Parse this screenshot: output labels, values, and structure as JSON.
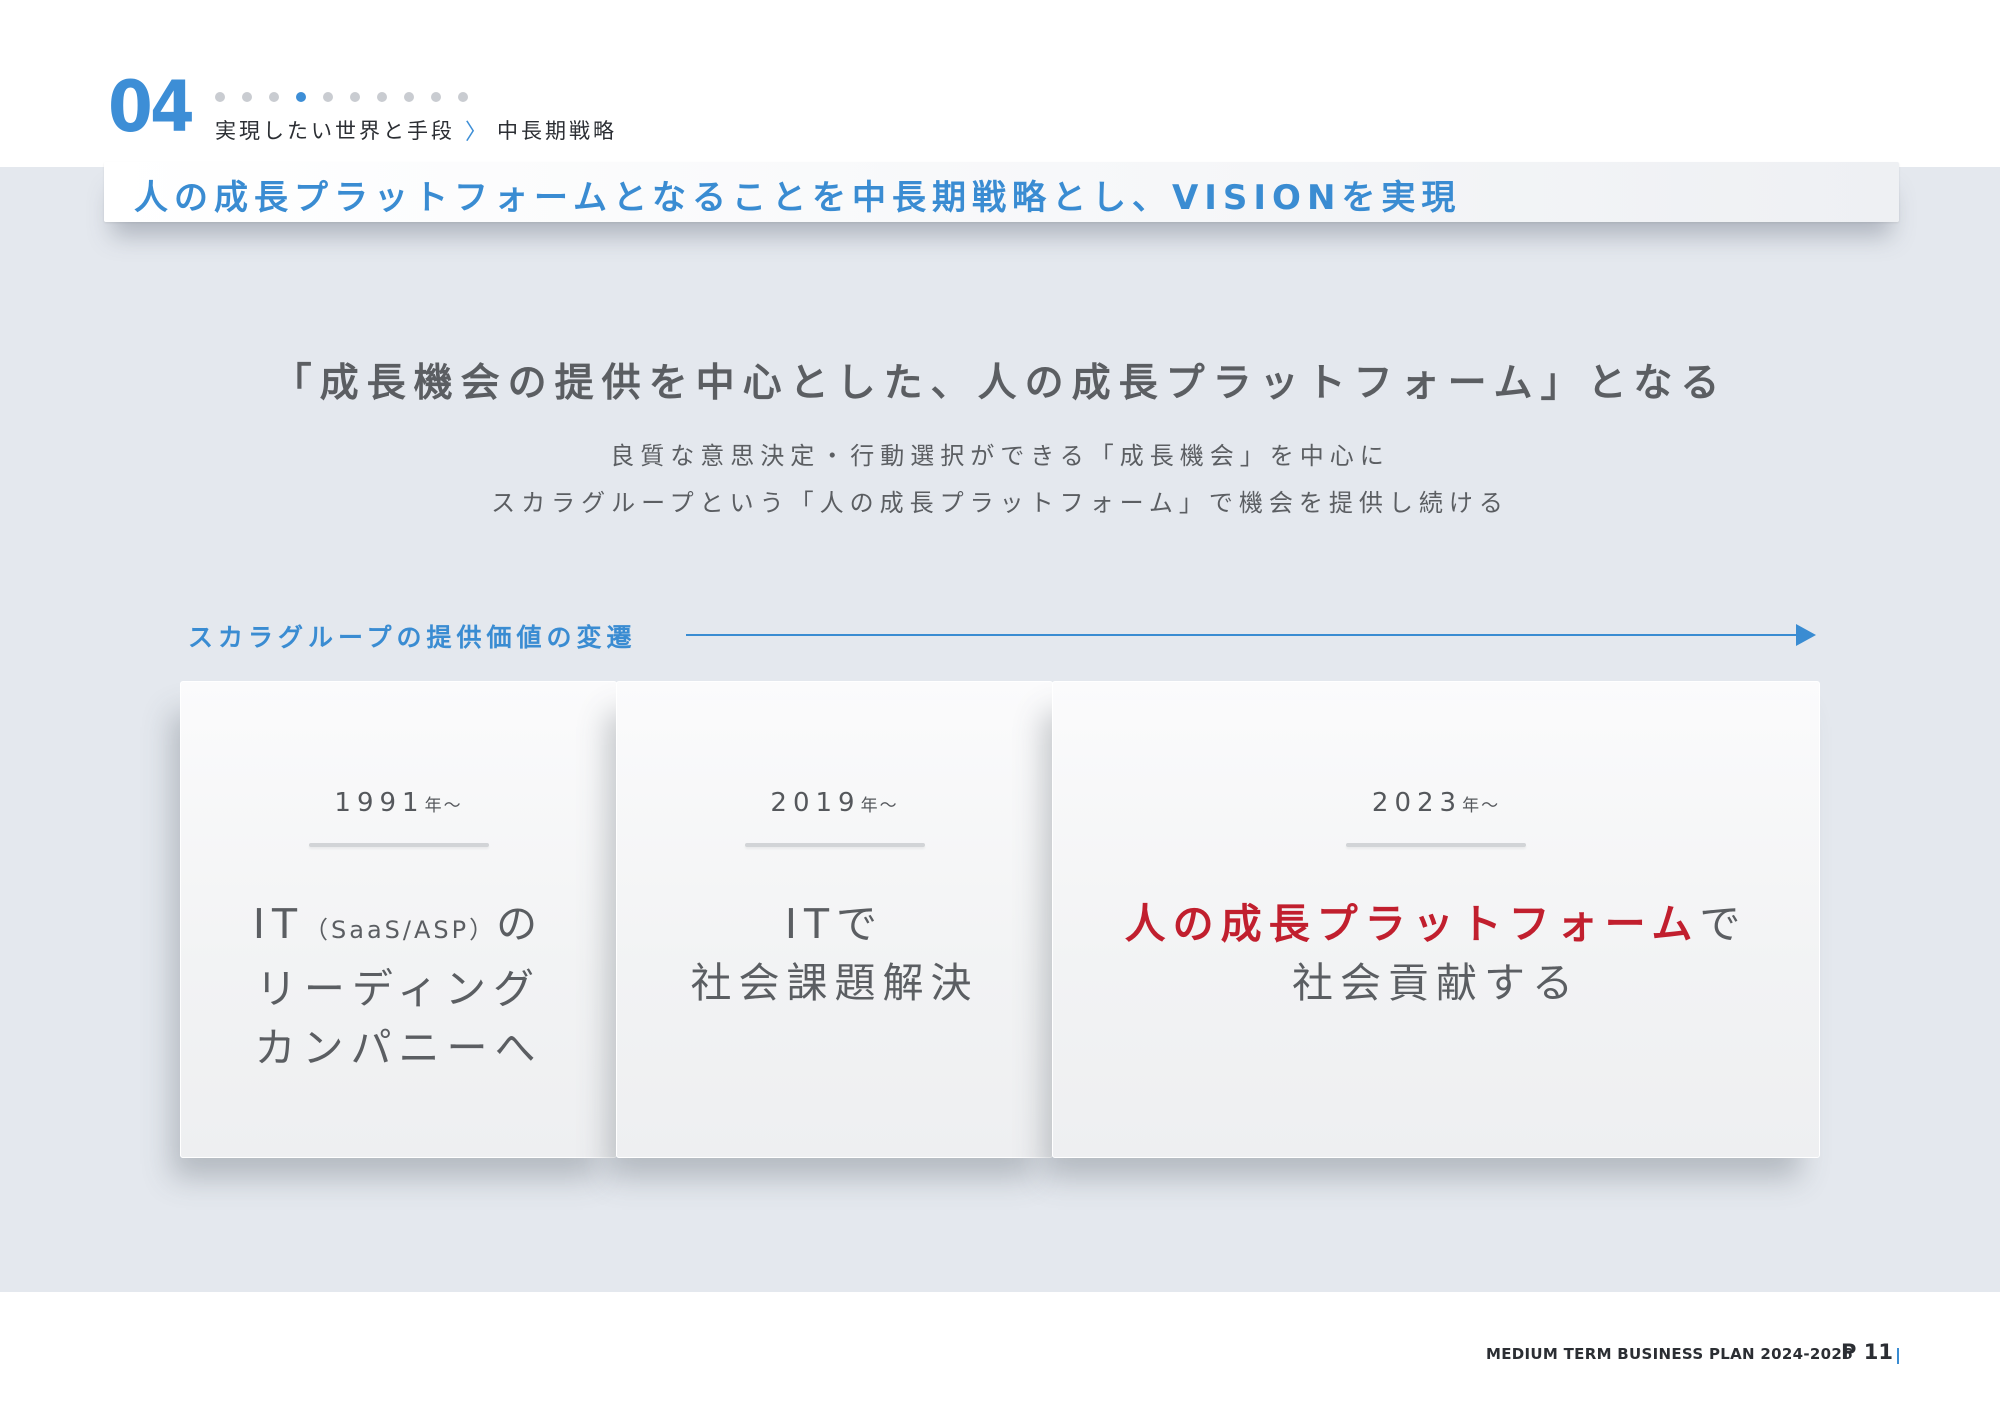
{
  "header": {
    "section_number": "04",
    "breadcrumb": [
      "実現したい世界と手段",
      "中長期戦略"
    ],
    "breadcrumb_separator": "〉",
    "progress_dots_total": 10,
    "progress_dot_active_index": 3,
    "title": "人の成長プラットフォームとなることを中長期戦略とし、VISIONを実現"
  },
  "mission": {
    "headline": "「成長機会の提供を中心とした、人の成長プラットフォーム」となる",
    "sub_lines": [
      "良質な意思決定・行動選択ができる「成長機会」を中心に",
      "スカラグループという「人の成長プラットフォーム」で機会を提供し続ける"
    ]
  },
  "transition": {
    "label": "スカラグループの提供価値の変遷",
    "stages": [
      {
        "year_num": "1991",
        "year_suffix": "年〜",
        "line1_a": "IT",
        "line1_small": "（SaaS/ASP）",
        "line1_b": "の",
        "line2": "リーディング",
        "line3": "カンパニーへ"
      },
      {
        "year_num": "2019",
        "year_suffix": "年〜",
        "line1": "ITで",
        "line2": "社会課題解決"
      },
      {
        "year_num": "2023",
        "year_suffix": "年〜",
        "line1_highlight": "人の成長プラットフォーム",
        "line1_rest": "で",
        "line2": "社会貢献する"
      }
    ]
  },
  "footer": {
    "plan_label": "MEDIUM TERM BUSINESS PLAN 2024-2026",
    "page_label": "P 11"
  },
  "colors": {
    "accent_blue": "#3a8cd2",
    "highlight_red": "#c11f2e",
    "band_gray": "#e4e8ee",
    "text_gray": "#5b5e62"
  }
}
